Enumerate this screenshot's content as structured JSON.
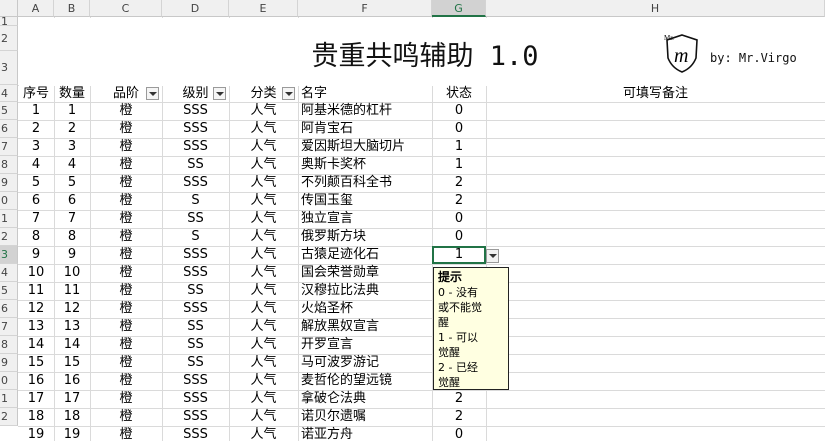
{
  "columns": [
    "A",
    "B",
    "C",
    "D",
    "E",
    "F",
    "G",
    "H"
  ],
  "selected_column": "G",
  "row_labels": [
    "1",
    "2",
    "3",
    "4",
    "5",
    "6",
    "7",
    "8",
    "9",
    "0",
    "1",
    "2",
    "3",
    "4",
    "5",
    "6",
    "7",
    "8",
    "9",
    "0",
    "1",
    "2"
  ],
  "selected_row_label": "2",
  "title": "贵重共鸣辅助 1.0",
  "byline": "by: Mr.Virgo",
  "logo": {
    "caption": "Mr.",
    "letter": "m"
  },
  "headers": [
    "序号",
    "数量",
    "品阶",
    "级别",
    "分类",
    "名字",
    "状态",
    "可填写备注"
  ],
  "rows": [
    [
      "1",
      "1",
      "橙",
      "SSS",
      "人气",
      "阿基米德的杠杆",
      "0"
    ],
    [
      "2",
      "2",
      "橙",
      "SSS",
      "人气",
      "阿肯宝石",
      "0"
    ],
    [
      "3",
      "3",
      "橙",
      "SSS",
      "人气",
      "爱因斯坦大脑切片",
      "1"
    ],
    [
      "4",
      "4",
      "橙",
      "SS",
      "人气",
      "奥斯卡奖杯",
      "1"
    ],
    [
      "5",
      "5",
      "橙",
      "SSS",
      "人气",
      "不列颠百科全书",
      "2"
    ],
    [
      "6",
      "6",
      "橙",
      "S",
      "人气",
      "传国玉玺",
      "2"
    ],
    [
      "7",
      "7",
      "橙",
      "SS",
      "人气",
      "独立宣言",
      "0"
    ],
    [
      "8",
      "8",
      "橙",
      "S",
      "人气",
      "俄罗斯方块",
      "0"
    ],
    [
      "9",
      "9",
      "橙",
      "SSS",
      "人气",
      "古猿足迹化石",
      "1"
    ],
    [
      "10",
      "10",
      "橙",
      "SSS",
      "人气",
      "国会荣誉勋章",
      ""
    ],
    [
      "11",
      "11",
      "橙",
      "SS",
      "人气",
      "汉穆拉比法典",
      ""
    ],
    [
      "12",
      "12",
      "橙",
      "SSS",
      "人气",
      "火焰圣杯",
      ""
    ],
    [
      "13",
      "13",
      "橙",
      "SS",
      "人气",
      "解放黑奴宣言",
      ""
    ],
    [
      "14",
      "14",
      "橙",
      "SS",
      "人气",
      "开罗宣言",
      ""
    ],
    [
      "15",
      "15",
      "橙",
      "SS",
      "人气",
      "马可波罗游记",
      ""
    ],
    [
      "16",
      "16",
      "橙",
      "SSS",
      "人气",
      "麦哲伦的望远镜",
      ""
    ],
    [
      "17",
      "17",
      "橙",
      "SSS",
      "人气",
      "拿破仑法典",
      "2"
    ],
    [
      "18",
      "18",
      "橙",
      "SSS",
      "人气",
      "诺贝尔遗嘱",
      "2"
    ],
    [
      "19",
      "19",
      "橙",
      "SSS",
      "人气",
      "诺亚方舟",
      "0"
    ]
  ],
  "tooltip": {
    "title": "提示",
    "lines": [
      "0 - 没有",
      "或不能觉",
      "醒",
      "1 - 可以",
      "觉醒",
      "2 - 已经",
      "觉醒"
    ]
  }
}
